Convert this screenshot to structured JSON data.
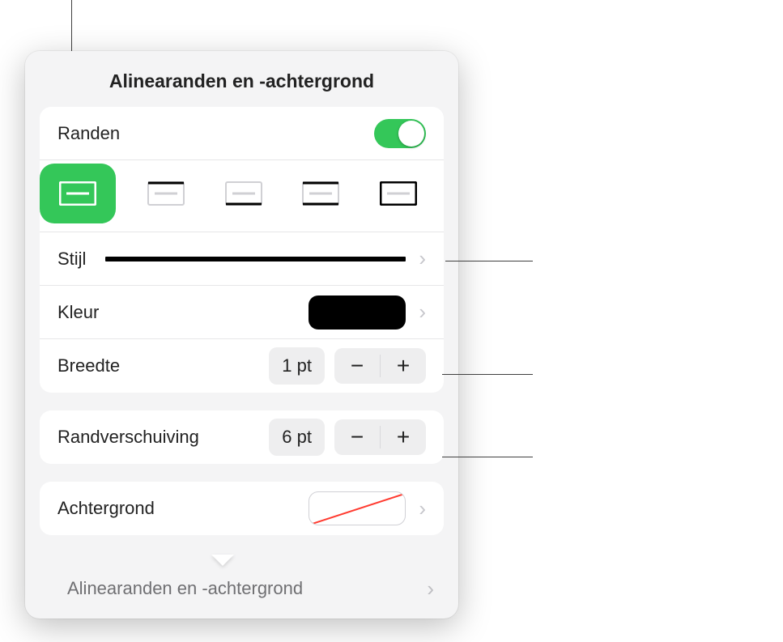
{
  "title": "Alinearanden en -achtergrond",
  "randen": {
    "label": "Randen",
    "toggle_on": true
  },
  "border_position": {
    "selected_index": 0,
    "options": [
      "all",
      "top",
      "bottom",
      "left",
      "right"
    ]
  },
  "stijl": {
    "label": "Stijl"
  },
  "kleur": {
    "label": "Kleur",
    "value": "#000000"
  },
  "breedte": {
    "label": "Breedte",
    "value": "1 pt"
  },
  "randverschuiving": {
    "label": "Randverschuiving",
    "value": "6 pt"
  },
  "achtergrond": {
    "label": "Achtergrond",
    "value": "none"
  },
  "under_menu": {
    "label": "Alinearanden en -achtergrond"
  },
  "callouts": {
    "top": "",
    "stijl": "",
    "breedte": "",
    "randverschuiving": ""
  }
}
